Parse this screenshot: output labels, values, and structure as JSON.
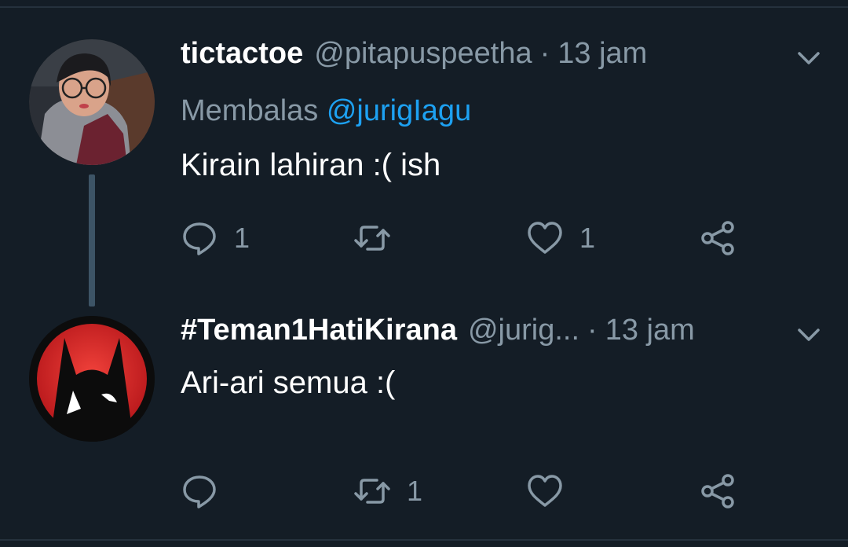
{
  "tweets": [
    {
      "display_name": "tictactoe",
      "handle": "@pitapuspeetha",
      "separator": "·",
      "time": "13 jam",
      "reply_prefix": "Membalas",
      "reply_mention": "@jurigIagu",
      "text": "Kirain lahiran :( ish",
      "actions": {
        "reply_count": "1",
        "retweet_count": "",
        "like_count": "1"
      },
      "avatar_icon": "user-photo-avatar"
    },
    {
      "display_name": "#Teman1HatiKirana",
      "handle": "@jurig...",
      "separator": "·",
      "time": "13 jam",
      "text": "Ari-ari semua :(",
      "actions": {
        "reply_count": "",
        "retweet_count": "1",
        "like_count": ""
      },
      "avatar_icon": "batman-logo-avatar"
    }
  ],
  "colors": {
    "background": "#141d26",
    "muted_text": "#8899a6",
    "link": "#1da1f2",
    "thread_line": "#3d5466"
  }
}
